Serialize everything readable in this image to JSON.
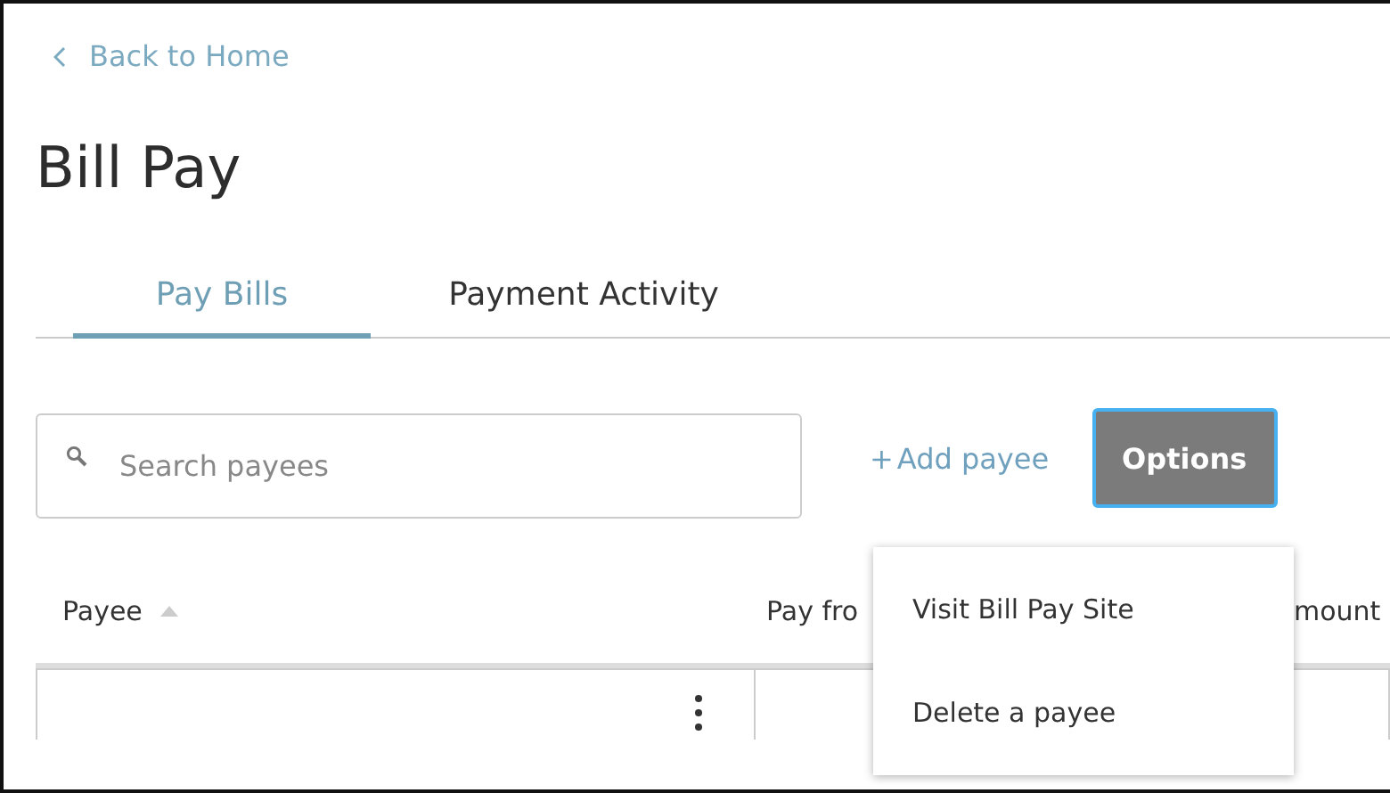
{
  "back_link": {
    "label": "Back to Home"
  },
  "page_title": "Bill Pay",
  "tabs": [
    {
      "label": "Pay Bills",
      "selected": true
    },
    {
      "label": "Payment Activity",
      "selected": false
    }
  ],
  "search": {
    "placeholder": "Search payees"
  },
  "add_payee": {
    "icon": "+",
    "label": "Add payee"
  },
  "options_button": {
    "label": "Options"
  },
  "options_menu": [
    "Visit Bill Pay Site",
    "Delete a payee"
  ],
  "table": {
    "columns": [
      {
        "label": "Payee",
        "sorted": true
      },
      {
        "label": "Pay fro",
        "sorted": false
      },
      {
        "label": "mount",
        "sorted": false
      }
    ]
  }
}
